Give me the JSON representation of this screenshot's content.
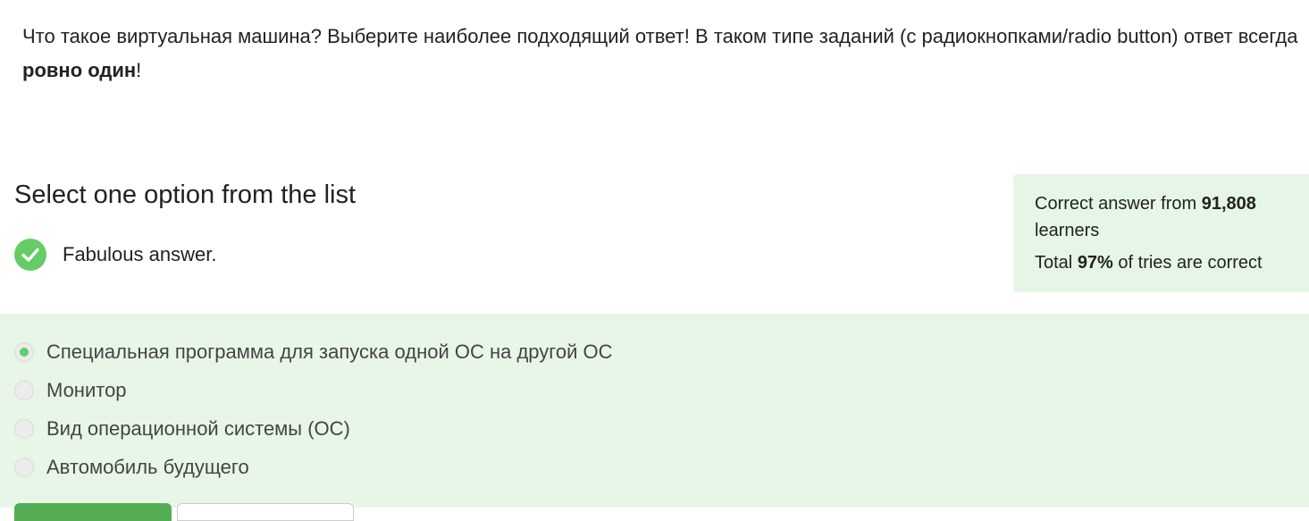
{
  "question": {
    "text_before": "Что такое виртуальная машина? Выберите наиболее подходящий ответ! В таком типе заданий (с радиокнопками/radio button) ответ всегда ",
    "bold": "ровно один",
    "text_after": "!"
  },
  "task": {
    "title": "Select one option from the list",
    "feedback": "Fabulous answer.",
    "feedback_icon": "check-circle-icon",
    "feedback_color": "#66cc66"
  },
  "stats": {
    "correct_prefix": "Correct answer from ",
    "learners_count": "91,808",
    "learners_suffix": " learners",
    "total_prefix": "Total ",
    "percent": "97%",
    "total_suffix": " of tries are correct"
  },
  "options": [
    {
      "label": "Специальная программа для запуска одной ОС на другой ОС",
      "selected": true
    },
    {
      "label": "Монитор",
      "selected": false
    },
    {
      "label": "Вид операционной системы (ОС)",
      "selected": false
    },
    {
      "label": "Автомобиль будущего",
      "selected": false
    }
  ],
  "buttons": {
    "primary_label": "",
    "secondary_label": ""
  },
  "colors": {
    "accent": "#66cc66",
    "panel_bg": "#e8f6e8",
    "stats_bg": "#e6f6e6"
  }
}
